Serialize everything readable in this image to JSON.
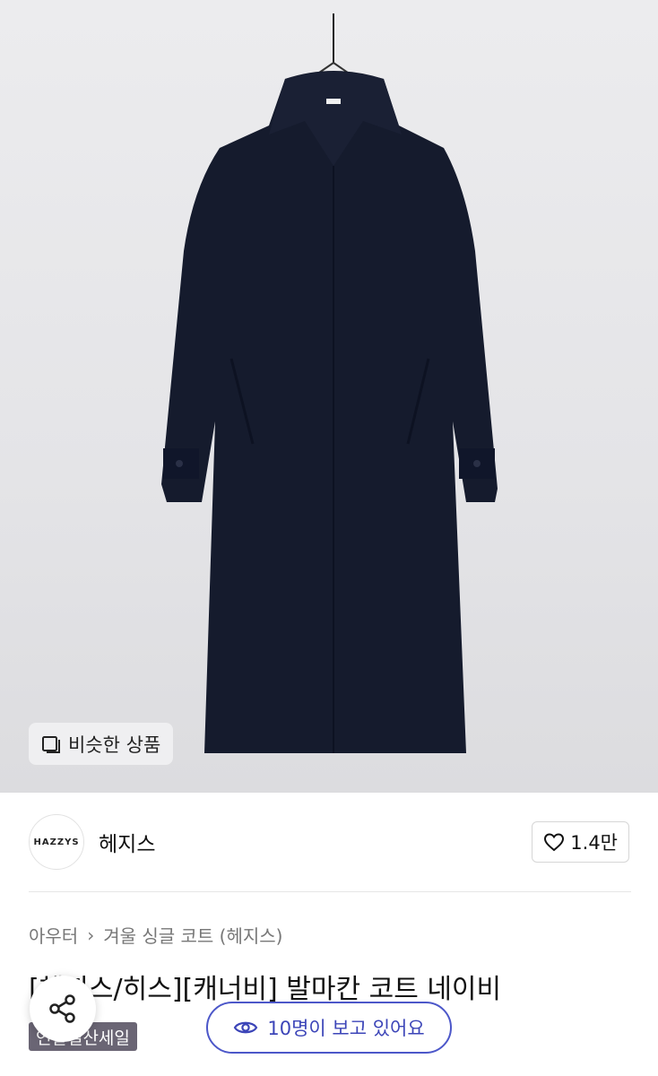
{
  "product_image": {
    "alt": "",
    "similar_button_label": "비슷한 상품",
    "similar_icon": "similar-icon"
  },
  "brand": {
    "logo_text": "HAZZYS",
    "name": "헤지스",
    "like_count": "1.4만",
    "like_icon": "heart-icon"
  },
  "breadcrumb": {
    "category": "아우터",
    "subcategory": "겨울 싱글 코트 (헤지스)"
  },
  "product": {
    "title": "[헤지스/히스][캐너비] 발마칸 코트 네이비",
    "badge": "연말결산세일"
  },
  "floating": {
    "share_icon": "share-icon",
    "viewers_text": "10명이 보고 있어요",
    "viewers_icon": "eye-icon"
  },
  "colors": {
    "accent": "#4c57c9",
    "badge_bg": "#6a6574",
    "coat": "#141a2c"
  }
}
